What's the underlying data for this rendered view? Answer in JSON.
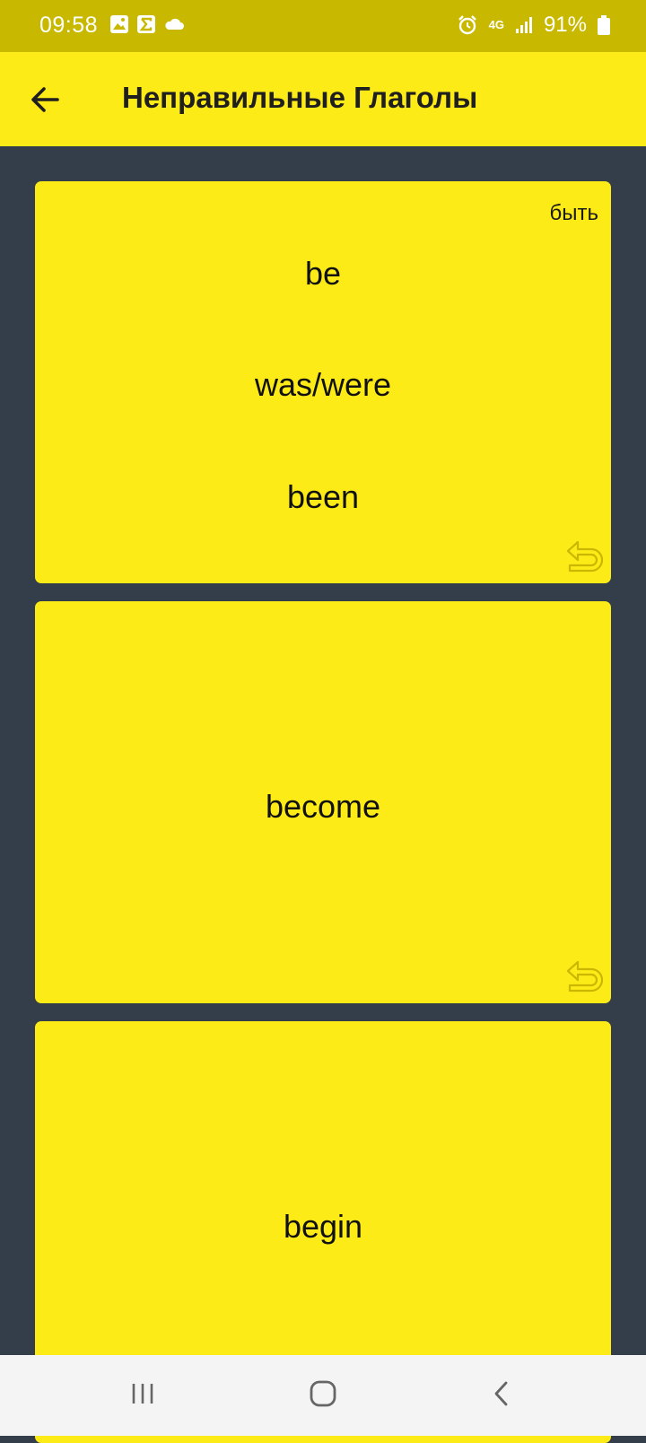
{
  "status": {
    "time": "09:58",
    "network": "4G",
    "battery": "91%"
  },
  "header": {
    "title": "Неправильные Глаголы"
  },
  "cards": [
    {
      "translation": "быть",
      "forms": [
        "be",
        "was/were",
        "been"
      ]
    },
    {
      "word": "become"
    },
    {
      "word": "begin"
    }
  ],
  "colors": {
    "status_bar": "#c8b900",
    "app_bar": "#fdeb17",
    "card": "#fdeb17",
    "background": "#343d4a",
    "undo_icon": "#d4c200"
  }
}
